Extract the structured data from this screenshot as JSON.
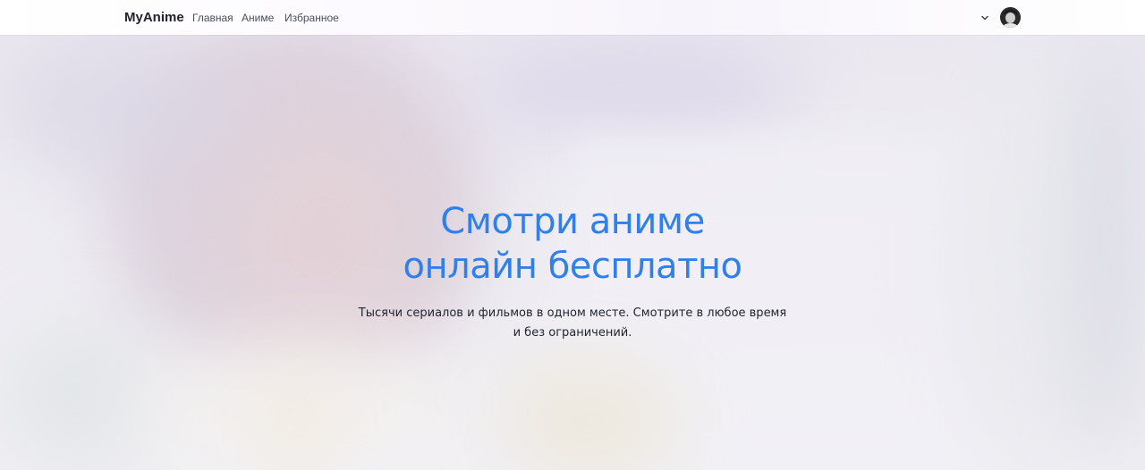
{
  "navbar": {
    "brand": "MyAnime",
    "links": [
      {
        "label": "Главная"
      },
      {
        "label": "Аниме"
      },
      {
        "label": "Избранное"
      }
    ],
    "user_menu": {
      "chevron_icon": "chevron-down-icon",
      "avatar_icon": "user-avatar"
    }
  },
  "hero": {
    "title_line1": "Смотри аниме",
    "title_line2": "онлайн бесплатно",
    "subtitle_line1": "Тысячи сериалов и фильмов в одном месте. Смотрите в любое время",
    "subtitle_line2": "и без ограничений."
  },
  "colors": {
    "accent": "#2f80ed",
    "text_dark": "#1f2330"
  }
}
